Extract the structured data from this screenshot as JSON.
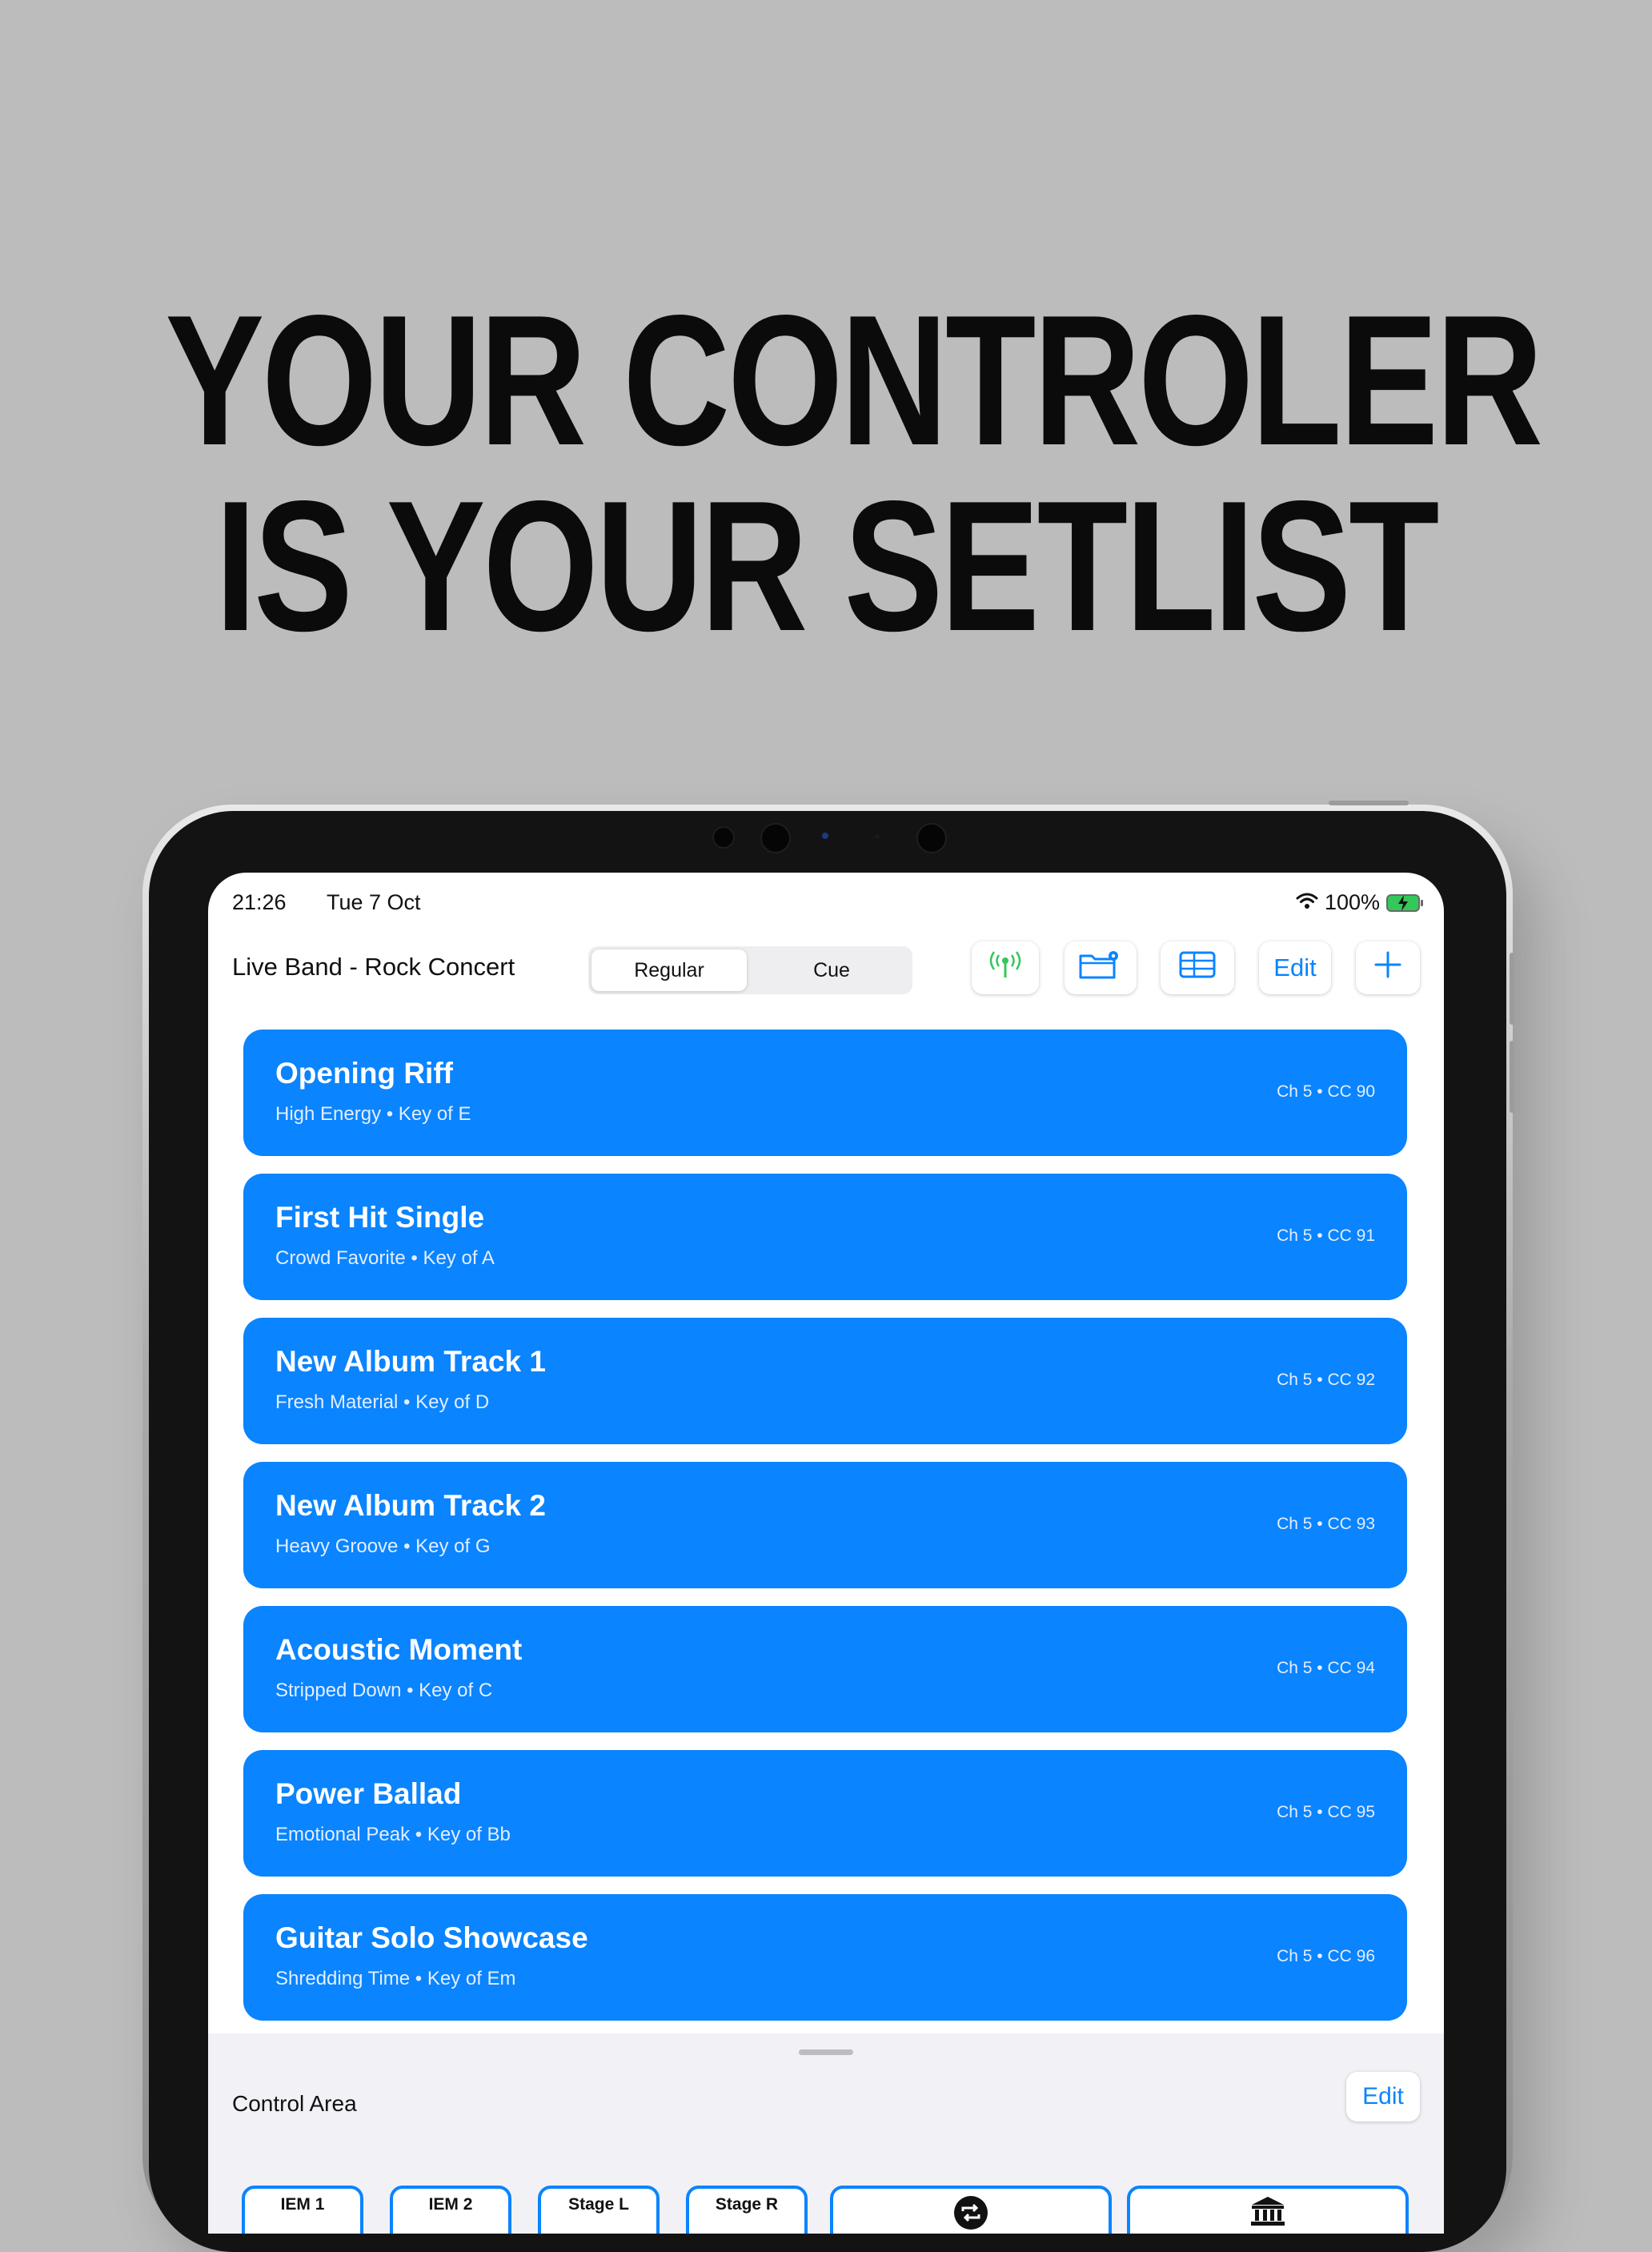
{
  "headline": {
    "line1": "YOUR CONTROLER",
    "line2": "IS YOUR SETLIST"
  },
  "status_bar": {
    "time": "21:26",
    "date": "Tue 7 Oct",
    "battery": "100%",
    "icons": [
      "wifi-icon",
      "battery-charging-icon"
    ]
  },
  "nav": {
    "title": "Live Band - Rock Concert",
    "segments": [
      "Regular",
      "Cue"
    ],
    "selected_segment": "Regular",
    "edit_label": "Edit",
    "icons": [
      "broadcast-icon",
      "folder-settings-icon",
      "table-icon",
      "plus-icon"
    ]
  },
  "songs": [
    {
      "title": "Opening Riff",
      "subtitle": "High Energy • Key of E",
      "midi": "Ch 5  •  CC 90"
    },
    {
      "title": "First Hit Single",
      "subtitle": "Crowd Favorite • Key of A",
      "midi": "Ch 5  •  CC 91"
    },
    {
      "title": "New Album Track 1",
      "subtitle": "Fresh Material • Key of D",
      "midi": "Ch 5  •  CC 92"
    },
    {
      "title": "New Album Track 2",
      "subtitle": "Heavy Groove • Key of G",
      "midi": "Ch 5  •  CC 93"
    },
    {
      "title": "Acoustic Moment",
      "subtitle": "Stripped Down • Key of C",
      "midi": "Ch 5  •  CC 94"
    },
    {
      "title": "Power Ballad",
      "subtitle": "Emotional Peak • Key of Bb",
      "midi": "Ch 5  •  CC 95"
    },
    {
      "title": "Guitar Solo Showcase",
      "subtitle": "Shredding Time • Key of Em",
      "midi": "Ch 5  •  CC 96"
    }
  ],
  "control_area": {
    "title": "Control Area",
    "edit_label": "Edit",
    "controls": [
      "IEM 1",
      "IEM 2",
      "Stage L",
      "Stage R"
    ],
    "icon_controls": [
      "repeat-icon",
      "bank-icon"
    ]
  },
  "colors": {
    "accent": "#0a84ff",
    "background": "#bcbcbc",
    "broadcast_green": "#34c759"
  }
}
